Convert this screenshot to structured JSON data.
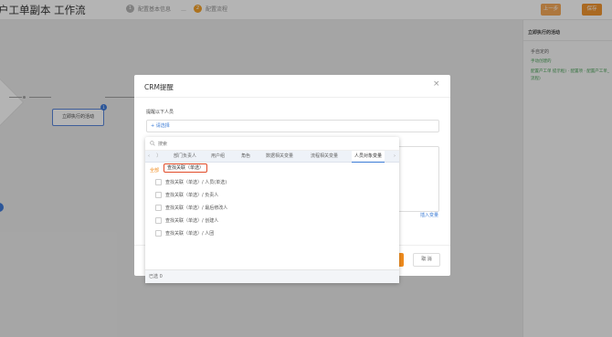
{
  "header": {
    "title": "户工单副本 工作流",
    "steps": [
      {
        "num": "1",
        "label": "配置基本信息"
      },
      {
        "num": "2",
        "label": "配置流程"
      }
    ],
    "prev_label": "上一步",
    "save_label": "保存"
  },
  "canvas": {
    "node_label": "立即执行的活动",
    "node_badge": "1"
  },
  "right_panel": {
    "title": "立即执行的活动",
    "subtitle": "手自定的",
    "link1": "手动创建的",
    "link2": "配置产工单 提示框) · 配置项 · 配置产工单_流程)"
  },
  "modal": {
    "title": "CRM提醒",
    "close": "×",
    "remind_label": "提醒以下人员",
    "select_label": "+ 请选择",
    "insert_var": "插入变量",
    "cancel_label": "取 消"
  },
  "dropdown": {
    "search_placeholder": "搜索",
    "tabs": [
      "部门负责人",
      "用户组",
      "角色",
      "数据相关变量",
      "流程相关变量",
      "人员对象变量"
    ],
    "breadcrumb_prefix": "全部",
    "breadcrumb_selected": "查找关联（单选）",
    "options": [
      "查找关联（单选）/ 人员(单选)",
      "查找关联（单选）/ 负责人",
      "查找关联（单选）/ 最后修改人",
      "查找关联（单选）/ 创建人",
      "查找关联（单选）/ 人团"
    ],
    "footer": "已选 0"
  }
}
